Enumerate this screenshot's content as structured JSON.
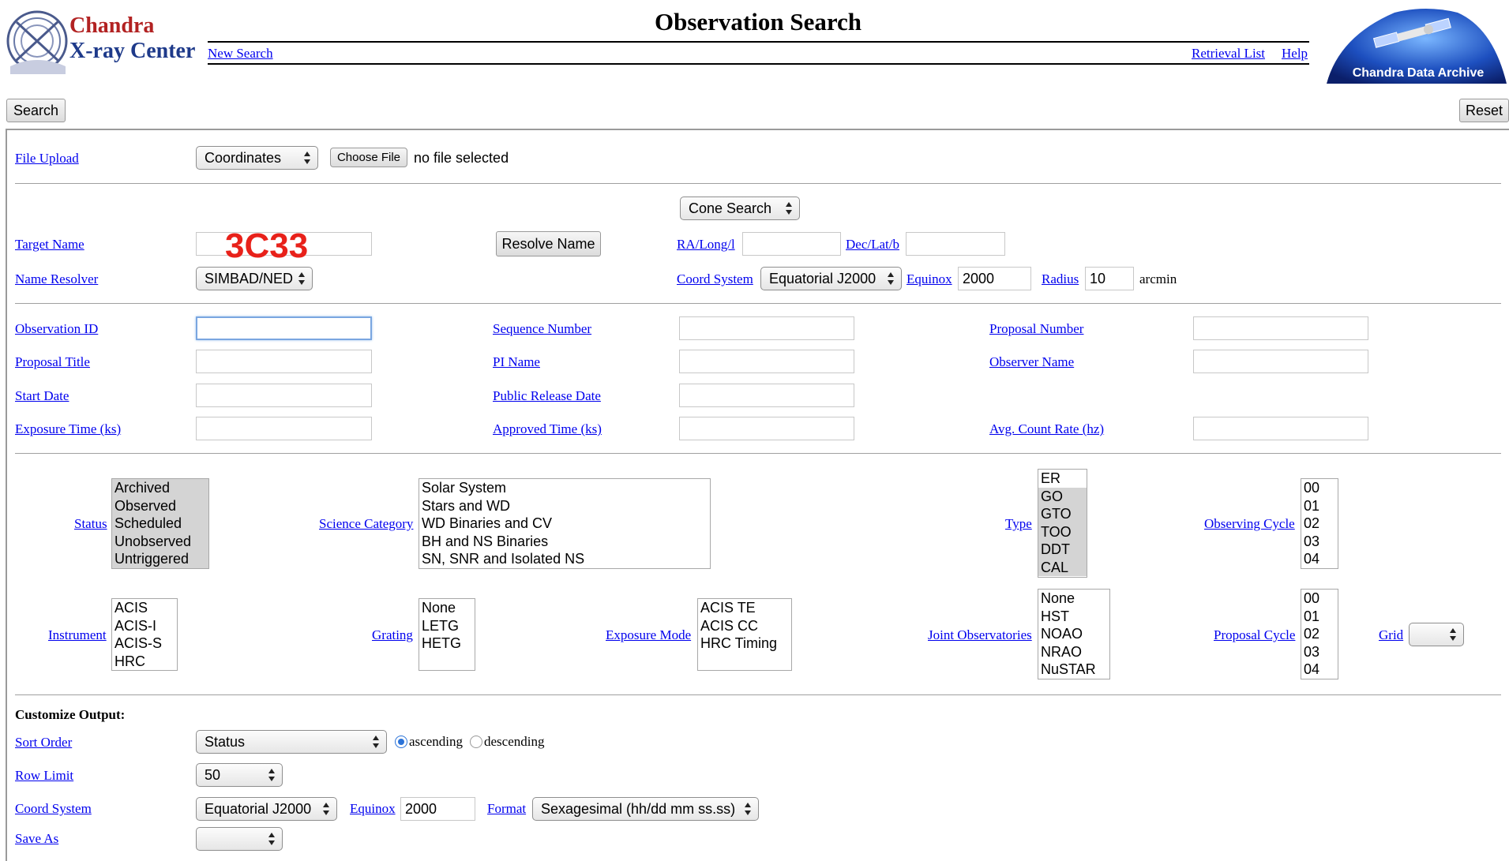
{
  "header": {
    "logo_line1": "Chandra",
    "logo_line2": "X-ray Center",
    "title": "Observation Search",
    "new_search": "New Search",
    "retrieval_list": "Retrieval List",
    "help": "Help",
    "archive_logo_text": "Chandra Data Archive"
  },
  "toolbar": {
    "search": "Search",
    "reset": "Reset"
  },
  "upload": {
    "label": "File Upload",
    "type": "Coordinates",
    "choose": "Choose File",
    "status": "no file selected"
  },
  "target": {
    "cone": "Cone Search",
    "name_label": "Target Name",
    "name_value": "3C33",
    "resolve": "Resolve Name",
    "ra_label": "RA/Long/l",
    "dec_label": "Dec/Lat/b",
    "resolver_label": "Name Resolver",
    "resolver_value": "SIMBAD/NED",
    "coord_label": "Coord System",
    "coord_value": "Equatorial J2000",
    "equinox_label": "Equinox",
    "equinox_value": "2000",
    "radius_label": "Radius",
    "radius_value": "10",
    "radius_unit": "arcmin"
  },
  "fields": {
    "obs_id": "Observation ID",
    "seq_num": "Sequence Number",
    "prop_num": "Proposal Number",
    "prop_title": "Proposal Title",
    "pi_name": "PI Name",
    "observer_name": "Observer Name",
    "start_date": "Start Date",
    "public_release": "Public Release Date",
    "exposure": "Exposure Time (ks)",
    "approved": "Approved Time (ks)",
    "count_rate": "Avg. Count Rate (hz)"
  },
  "lists": {
    "status": {
      "label": "Status",
      "items": [
        "Archived",
        "Observed",
        "Scheduled",
        "Unobserved",
        "Untriggered"
      ]
    },
    "science": {
      "label": "Science Category",
      "items": [
        "Solar System",
        "Stars and WD",
        "WD Binaries and CV",
        "BH and NS Binaries",
        "SN, SNR and Isolated NS"
      ]
    },
    "type": {
      "label": "Type",
      "items": [
        "ER",
        "GO",
        "GTO",
        "TOO",
        "DDT",
        "CAL"
      ]
    },
    "obs_cycle": {
      "label": "Observing Cycle",
      "items": [
        "00",
        "01",
        "02",
        "03",
        "04"
      ]
    },
    "instrument": {
      "label": "Instrument",
      "items": [
        "ACIS",
        "ACIS-I",
        "ACIS-S",
        "HRC"
      ]
    },
    "grating": {
      "label": "Grating",
      "items": [
        "None",
        "LETG",
        "HETG"
      ]
    },
    "exp_mode": {
      "label": "Exposure Mode",
      "items": [
        "ACIS TE",
        "ACIS CC",
        "HRC Timing"
      ]
    },
    "joint": {
      "label": "Joint Observatories",
      "items": [
        "None",
        "HST",
        "NOAO",
        "NRAO",
        "NuSTAR"
      ]
    },
    "prop_cycle": {
      "label": "Proposal Cycle",
      "items": [
        "00",
        "01",
        "02",
        "03",
        "04"
      ]
    },
    "grid": {
      "label": "Grid"
    }
  },
  "output": {
    "heading": "Customize Output:",
    "sort_label": "Sort Order",
    "sort_value": "Status",
    "ascending": "ascending",
    "descending": "descending",
    "row_limit_label": "Row Limit",
    "row_limit_value": "50",
    "coord_label": "Coord System",
    "coord_value": "Equatorial J2000",
    "equinox_label": "Equinox",
    "equinox_value": "2000",
    "format_label": "Format",
    "format_value": "Sexagesimal (hh/dd mm ss.ss)",
    "save_label": "Save As"
  },
  "colors": {
    "link": "#0000ee",
    "logo_red": "#b22222",
    "logo_blue": "#1e3a8a",
    "target_red": "#e8211a",
    "radio_blue": "#2b73d8"
  }
}
